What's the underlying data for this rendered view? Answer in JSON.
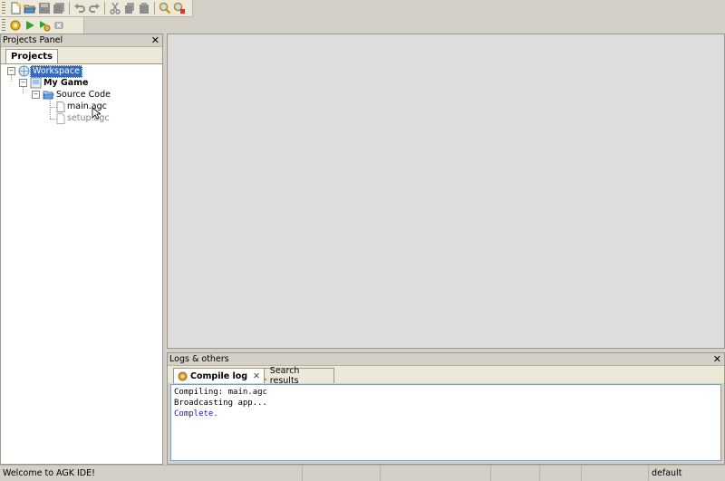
{
  "toolbar": {
    "row1": [
      "new-file-icon",
      "open-folder-icon",
      "save-icon",
      "save-all-icon",
      "undo-icon",
      "redo-icon",
      "cut-icon",
      "copy-icon",
      "paste-icon",
      "find-icon",
      "find-replace-icon"
    ],
    "row2": [
      "compile-icon",
      "run-icon",
      "broadcast-icon",
      "stop-icon"
    ]
  },
  "projects_panel": {
    "title": "Projects Panel",
    "close": "✕",
    "tab": "Projects",
    "tree": {
      "workspace": "Workspace",
      "project": "My Game",
      "folder": "Source Code",
      "files": [
        "main.agc",
        "setup.agc"
      ]
    }
  },
  "logs_panel": {
    "title": "Logs & others",
    "close": "✕",
    "tabs": {
      "compile_log": "Compile log",
      "compile_close": "✕",
      "search_results": "Search results"
    },
    "lines": [
      {
        "text": "Compiling: main.agc",
        "color": "#000000"
      },
      {
        "text": "Broadcasting app...",
        "color": "#000000"
      },
      {
        "text": "Complete.",
        "color": "#1a1aa8"
      }
    ]
  },
  "statusbar": {
    "message": "Welcome to AGK IDE!",
    "scheme": "default"
  }
}
